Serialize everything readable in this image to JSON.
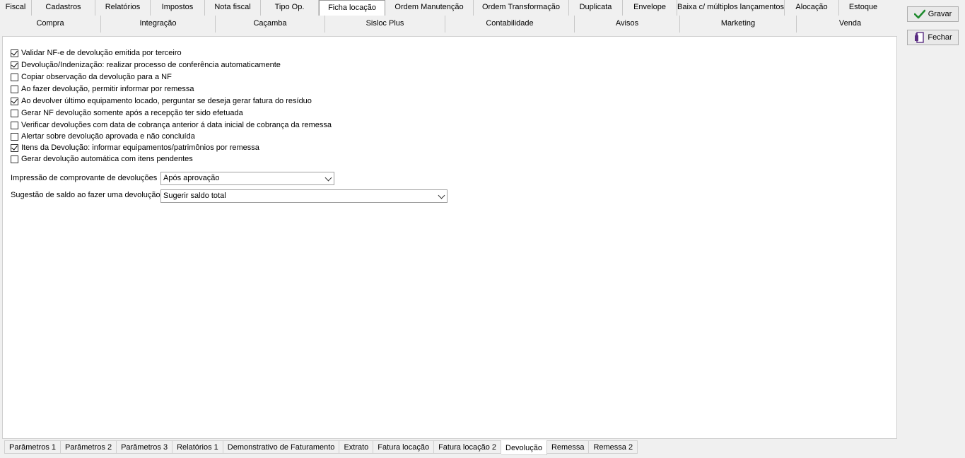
{
  "top_tabs_row1": [
    "Fiscal",
    "Cadastros",
    "Relatórios",
    "Impostos",
    "Nota fiscal",
    "Tipo Op.",
    "Ficha locação",
    "Ordem Manutenção",
    "Ordem Transformação",
    "Duplicata",
    "Envelope",
    "Baixa c/ múltiplos lançamentos",
    "Alocação",
    "Estoque"
  ],
  "top_tabs_row1_active": "Ficha locação",
  "top_tabs_row2": [
    "Compra",
    "Integração",
    "Caçamba",
    "Sisloc Plus",
    "Contabilidade",
    "Avisos",
    "Marketing",
    "Venda"
  ],
  "checkboxes": [
    {
      "label": "Validar NF-e de devolução emitida por terceiro",
      "checked": true
    },
    {
      "label": "Devolução/Indenização: realizar processo de conferência automaticamente",
      "checked": true
    },
    {
      "label": "Copiar observação da devolução para a NF",
      "checked": false
    },
    {
      "label": "Ao fazer devolução, permitir informar por remessa",
      "checked": false
    },
    {
      "label": "Ao devolver último equipamento locado, perguntar se deseja gerar fatura do resíduo",
      "checked": true
    },
    {
      "label": "Gerar NF devolução somente após a recepção ter sido efetuada",
      "checked": false
    },
    {
      "label": "Verificar devoluções com data de cobrança anterior á data inicial de cobrança da remessa",
      "checked": false
    },
    {
      "label": "Alertar sobre devolução aprovada e não concluída",
      "checked": false
    },
    {
      "label": "Itens da Devolução: informar equipamentos/patrimônios por remessa",
      "checked": true
    },
    {
      "label": "Gerar devolução automática com itens pendentes",
      "checked": false
    }
  ],
  "fields": {
    "impressao": {
      "label": "Impressão de comprovante de devoluções",
      "value": "Após aprovação"
    },
    "sugestao": {
      "label": "Sugestão de saldo ao fazer uma devolução",
      "value": "Sugerir saldo total"
    }
  },
  "bottom_tabs": [
    "Parâmetros 1",
    "Parâmetros 2",
    "Parâmetros 3",
    "Relatórios 1",
    "Demonstrativo de Faturamento",
    "Extrato",
    "Fatura locação",
    "Fatura locação 2",
    "Devolução",
    "Remessa",
    "Remessa 2"
  ],
  "bottom_tabs_active": "Devolução",
  "buttons": {
    "gravar": {
      "label": "Gravar",
      "icon": "check-icon"
    },
    "fechar": {
      "label": "Fechar",
      "icon": "exit-door-icon"
    }
  },
  "colors": {
    "check_green": "#1e8a2e",
    "door_purple": "#5a2d82"
  }
}
